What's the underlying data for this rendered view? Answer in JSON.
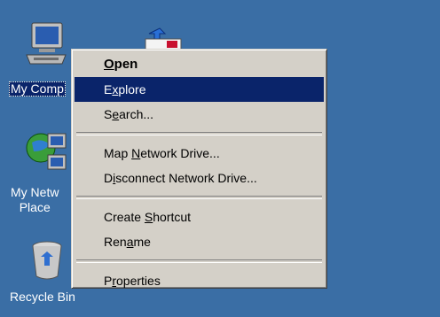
{
  "desktop": {
    "background": "#3a6ea5",
    "icons": {
      "my_computer": "My Comp",
      "network_line1": "My Netw",
      "network_line2": "Place",
      "recycle_bin": "Recycle Bin"
    }
  },
  "menu": {
    "items": [
      {
        "pre": "",
        "key": "O",
        "post": "pen"
      },
      {
        "pre": "E",
        "key": "x",
        "post": "plore"
      },
      {
        "pre": "S",
        "key": "e",
        "post": "arch..."
      },
      {
        "pre": "Map ",
        "key": "N",
        "post": "etwork Drive..."
      },
      {
        "pre": "D",
        "key": "i",
        "post": "sconnect Network Drive..."
      },
      {
        "pre": "Create ",
        "key": "S",
        "post": "hortcut"
      },
      {
        "pre": "Ren",
        "key": "a",
        "post": "me"
      },
      {
        "pre": "P",
        "key": "r",
        "post": "operties"
      }
    ],
    "highlight_color": "#0a246a",
    "background_color": "#d4d0c8"
  }
}
